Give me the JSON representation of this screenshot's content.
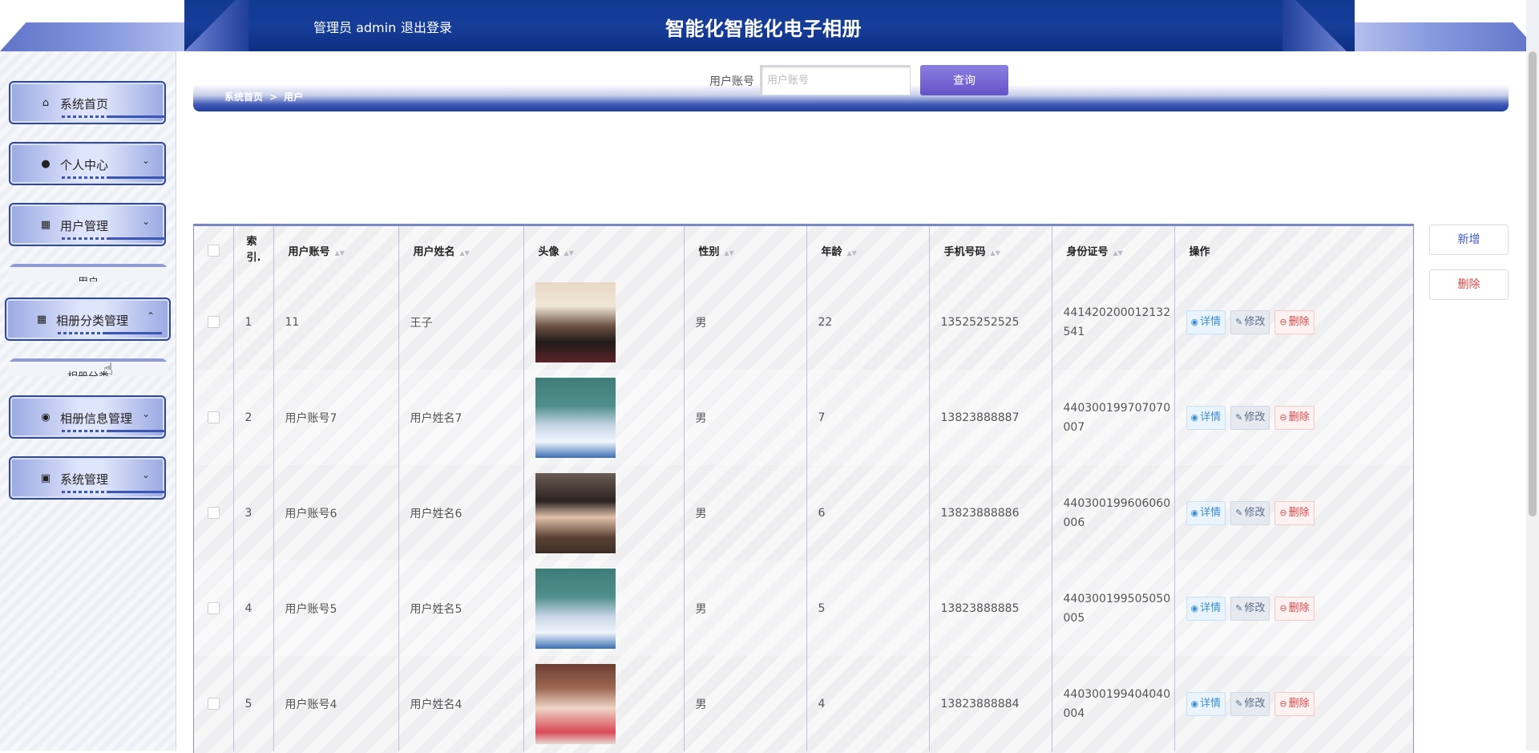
{
  "header": {
    "admin_label": "管理员 admin",
    "logout": "退出登录",
    "title": "智能化智能化电子相册"
  },
  "sidebar": {
    "items": [
      {
        "label": "系统首页",
        "icon": "home-icon"
      },
      {
        "label": "个人中心",
        "icon": "user-icon"
      },
      {
        "label": "用户管理",
        "icon": "grid-icon"
      },
      {
        "label": "用户"
      },
      {
        "label": "相册分类管理",
        "icon": "grid-icon"
      },
      {
        "label": "相册分类"
      },
      {
        "label": "相册信息管理",
        "icon": "bulb-icon"
      },
      {
        "label": "系统管理",
        "icon": "chat-icon"
      }
    ]
  },
  "breadcrumb": {
    "home": "系统首页",
    "separator": ">",
    "current": "用户"
  },
  "search": {
    "label": "用户账号",
    "placeholder": "用户账号",
    "button": "查询"
  },
  "actions": {
    "add": "新增",
    "delete": "删除"
  },
  "table": {
    "columns": [
      "索引",
      "用户账号",
      "用户姓名",
      "头像",
      "性别",
      "年龄",
      "手机号码",
      "身份证号",
      "操作"
    ],
    "index_header_top": "索",
    "index_header_bottom": "引.",
    "row_actions": {
      "detail": "详情",
      "edit": "修改",
      "delete": "删除"
    },
    "rows": [
      {
        "index": "1",
        "account": "11",
        "name": "王子",
        "gender": "男",
        "age": "22",
        "phone": "13525252525",
        "id_line1": "441420200012132",
        "id_line2": "541"
      },
      {
        "index": "2",
        "account": "用户账号7",
        "name": "用户姓名7",
        "gender": "男",
        "age": "7",
        "phone": "13823888887",
        "id_line1": "440300199707070",
        "id_line2": "007"
      },
      {
        "index": "3",
        "account": "用户账号6",
        "name": "用户姓名6",
        "gender": "男",
        "age": "6",
        "phone": "13823888886",
        "id_line1": "440300199606060",
        "id_line2": "006"
      },
      {
        "index": "4",
        "account": "用户账号5",
        "name": "用户姓名5",
        "gender": "男",
        "age": "5",
        "phone": "13823888885",
        "id_line1": "440300199505050",
        "id_line2": "005"
      },
      {
        "index": "5",
        "account": "用户账号4",
        "name": "用户姓名4",
        "gender": "男",
        "age": "4",
        "phone": "13823888884",
        "id_line1": "440300199404040",
        "id_line2": "004"
      }
    ]
  }
}
